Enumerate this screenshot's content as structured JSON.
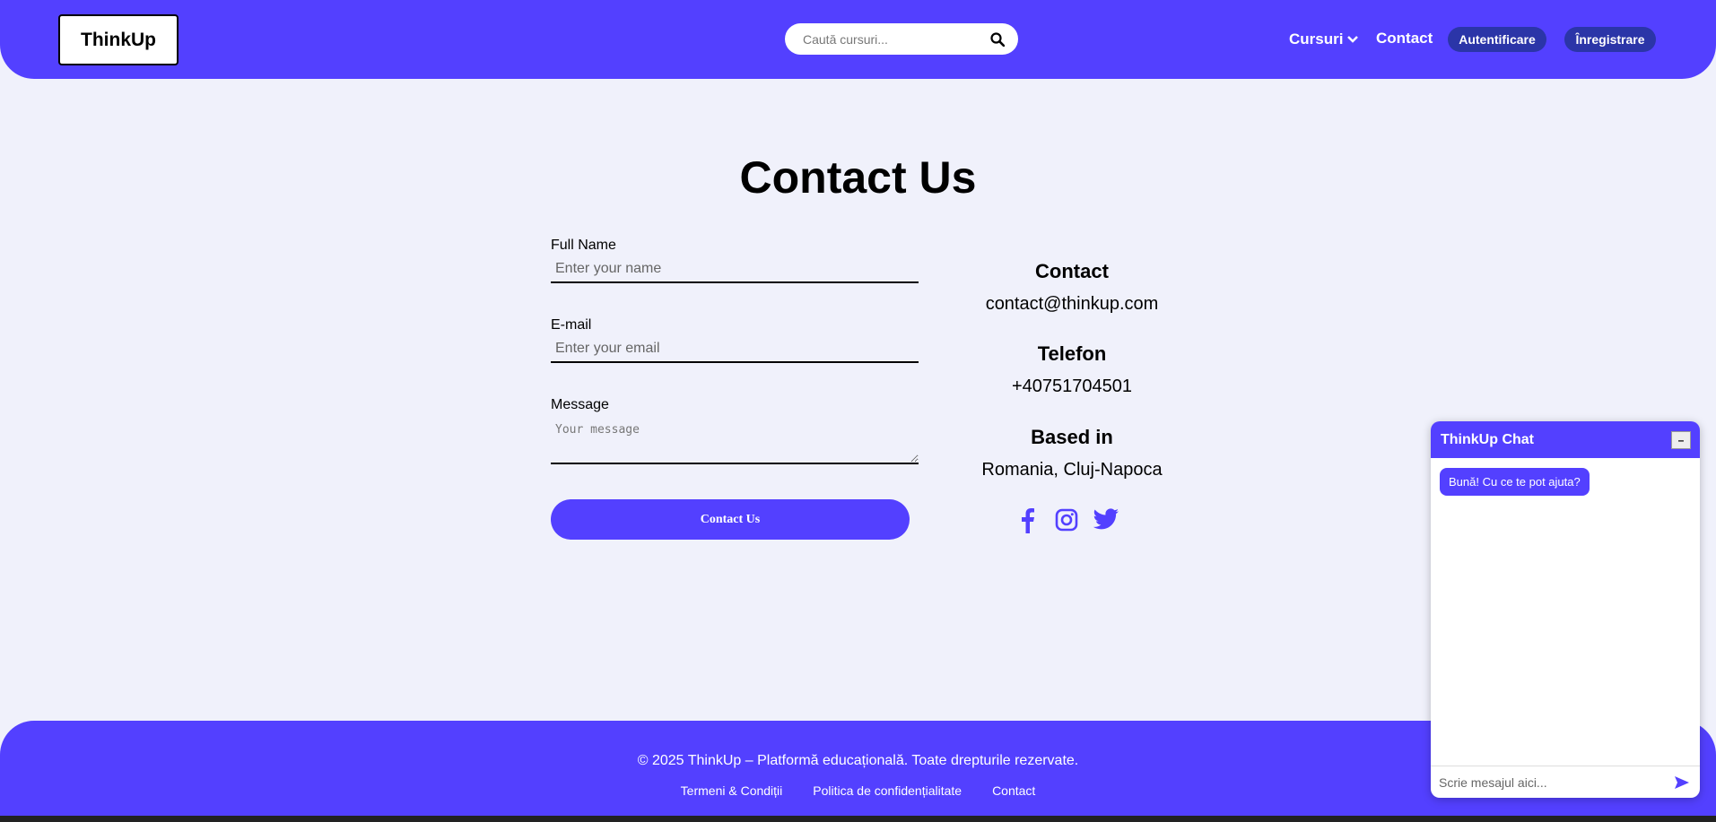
{
  "colors": {
    "brand": "#5340ff",
    "pill": "#2b35a8",
    "background": "#f0f1fb"
  },
  "header": {
    "logo": "ThinkUp",
    "search_placeholder": "Caută cursuri...",
    "search_icon": "search-icon",
    "nav_courses": "Cursuri",
    "nav_courses_icon": "chevron-down-icon",
    "nav_contact": "Contact",
    "login": "Autentificare",
    "register": "Înregistrare"
  },
  "main": {
    "title": "Contact Us",
    "form": {
      "name_label": "Full Name",
      "name_placeholder": "Enter your name",
      "email_label": "E-mail",
      "email_placeholder": "Enter your email",
      "message_label": "Message",
      "message_placeholder": "Your message",
      "submit": "Contact Us"
    },
    "info": {
      "contact_heading": "Contact",
      "contact_value": "contact@thinkup.com",
      "phone_heading": "Telefon",
      "phone_value": "+40751704501",
      "location_heading": "Based in",
      "location_value": "Romania, Cluj-Napoca"
    },
    "socials": [
      "facebook-icon",
      "instagram-icon",
      "twitter-icon"
    ]
  },
  "footer": {
    "copyright": "© 2025 ThinkUp – Platformă educațională. Toate drepturile rezervate.",
    "links": [
      "Termeni & Condiții",
      "Politica de confidențialitate",
      "Contact"
    ]
  },
  "chat": {
    "title": "ThinkUp Chat",
    "minimize": "–",
    "greeting": "Bună! Cu ce te pot ajuta?",
    "input_placeholder": "Scrie mesajul aici...",
    "send_icon": "send-icon"
  }
}
